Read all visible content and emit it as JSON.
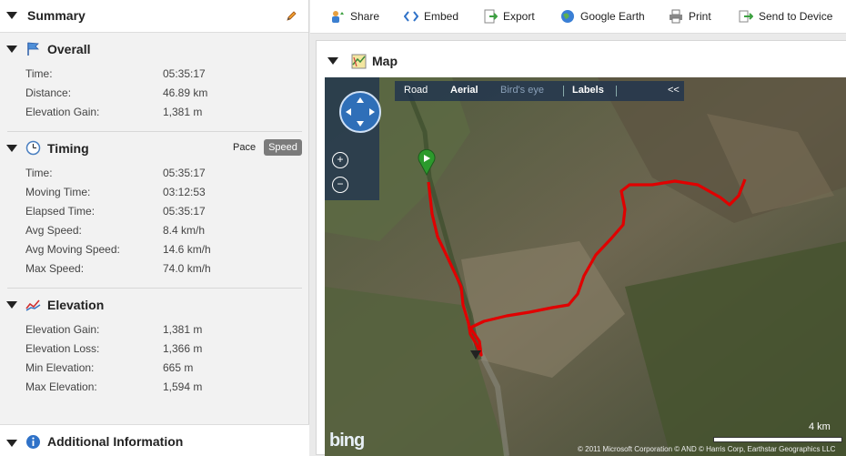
{
  "summary": {
    "title": "Summary",
    "edit_icon": "pencil-icon",
    "overall": {
      "title": "Overall",
      "icon": "flag-icon",
      "rows": [
        {
          "label": "Time:",
          "value": "05:35:17"
        },
        {
          "label": "Distance:",
          "value": "46.89 km"
        },
        {
          "label": "Elevation Gain:",
          "value": "1,381 m"
        }
      ]
    },
    "timing": {
      "title": "Timing",
      "icon": "clock-icon",
      "pace_label": "Pace",
      "speed_label": "Speed",
      "rows": [
        {
          "label": "Time:",
          "value": "05:35:17"
        },
        {
          "label": "Moving Time:",
          "value": "03:12:53"
        },
        {
          "label": "Elapsed Time:",
          "value": "05:35:17"
        },
        {
          "label": "Avg Speed:",
          "value": "8.4 km/h"
        },
        {
          "label": "Avg Moving Speed:",
          "value": "14.6 km/h"
        },
        {
          "label": "Max Speed:",
          "value": "74.0 km/h"
        }
      ]
    },
    "elevation": {
      "title": "Elevation",
      "icon": "elevation-chart-icon",
      "rows": [
        {
          "label": "Elevation Gain:",
          "value": "1,381 m"
        },
        {
          "label": "Elevation Loss:",
          "value": "1,366 m"
        },
        {
          "label": "Min Elevation:",
          "value": "665 m"
        },
        {
          "label": "Max Elevation:",
          "value": "1,594 m"
        }
      ]
    },
    "additional": {
      "title": "Additional Information",
      "icon": "info-icon"
    }
  },
  "toolbar": {
    "share": "Share",
    "embed": "Embed",
    "export": "Export",
    "google_earth": "Google Earth",
    "print": "Print",
    "send_to_device": "Send to Device"
  },
  "map": {
    "title": "Map",
    "icon": "map-icon",
    "modes": {
      "road": "Road",
      "aerial": "Aerial",
      "birds_eye": "Bird's eye",
      "labels": "Labels",
      "collapse": "<<"
    },
    "zoom_in": "+",
    "zoom_out": "−",
    "logo": "bing",
    "scale": "4 km",
    "copyright": "© 2011 Microsoft Corporation   © AND   © Harris Corp, Earthstar Geographics LLC",
    "colors": {
      "route": "#e00000",
      "nav_bg": "#1e3250",
      "start_marker": "#2c9a2c"
    }
  }
}
